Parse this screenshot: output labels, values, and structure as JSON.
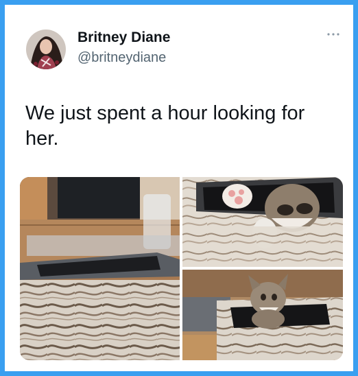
{
  "tweet": {
    "author_name": "Britney Diane",
    "author_handle": "@britneydiane",
    "text": "We just spent a hour looking for her.",
    "more_icon": "more-horizontal-icon",
    "media": [
      {
        "name": "photo-tissue-box-table"
      },
      {
        "name": "photo-kitten-paws-in-box"
      },
      {
        "name": "photo-kitten-peeking-from-box"
      }
    ]
  },
  "colors": {
    "frame_blue": "#3a9ff0",
    "name_text": "#0f1419",
    "handle_text": "#536471"
  }
}
